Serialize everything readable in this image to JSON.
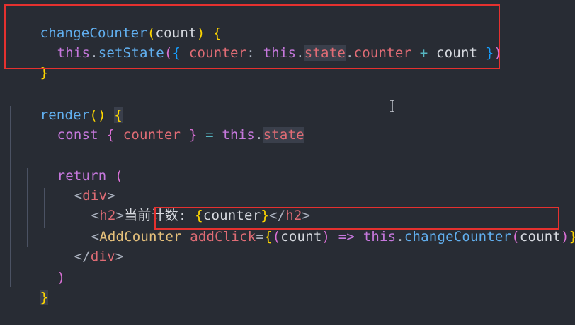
{
  "code": {
    "l1": {
      "name": "changeCounter",
      "p1": "(",
      "arg": "count",
      "p2": ")",
      "sp": " ",
      "b": "{"
    },
    "l2": {
      "this": "this",
      "dot1": ".",
      "fn": "setState",
      "p1": "(",
      "b1": "{",
      "sp1": " ",
      "key": "counter",
      "colon": ":",
      "sp2": " ",
      "this2": "this",
      "dot2": ".",
      "state": "state",
      "dot3": ".",
      "counter": "counter",
      "sp3": " ",
      "plus": "+",
      "sp4": " ",
      "count": "count",
      "sp5": " ",
      "b2": "}",
      "p2": ")"
    },
    "l3": {
      "b": "}"
    },
    "l5": {
      "name": "render",
      "parens": "()",
      "sp": " ",
      "b": "{"
    },
    "l6": {
      "const": "const",
      "sp1": " ",
      "b1": "{",
      "sp2": " ",
      "counter": "counter",
      "sp3": " ",
      "b2": "}",
      "sp4": " ",
      "eq": "=",
      "sp5": " ",
      "this": "this",
      "dot": ".",
      "state": "state"
    },
    "l8": {
      "ret": "return",
      "sp": " ",
      "p": "("
    },
    "l9": {
      "lt": "<",
      "tag": "div",
      "gt": ">"
    },
    "l10": {
      "lt": "<",
      "tag": "h2",
      "gt": ">",
      "text": "当前计数: ",
      "b1": "{",
      "counter": "counter",
      "b2": "}",
      "lt2": "</",
      "tag2": "h2",
      "gt2": ">"
    },
    "l11": {
      "lt": "<",
      "comp": "AddCounter",
      "sp": " ",
      "attr": "addClick",
      "eq": "=",
      "b1": "{",
      "p1": "(",
      "arg": "count",
      "p2": ")",
      "sp2": " ",
      "arrow": "=>",
      "sp3": " ",
      "this": "this",
      "dot": ".",
      "fn": "changeCounter",
      "p3": "(",
      "arg2": "count",
      "p4": ")",
      "b2": "}",
      "close": "/>"
    },
    "l12": {
      "lt": "</",
      "tag": "div",
      "gt": ">"
    },
    "l13": {
      "p": ")"
    },
    "l14": {
      "b": "}"
    }
  }
}
